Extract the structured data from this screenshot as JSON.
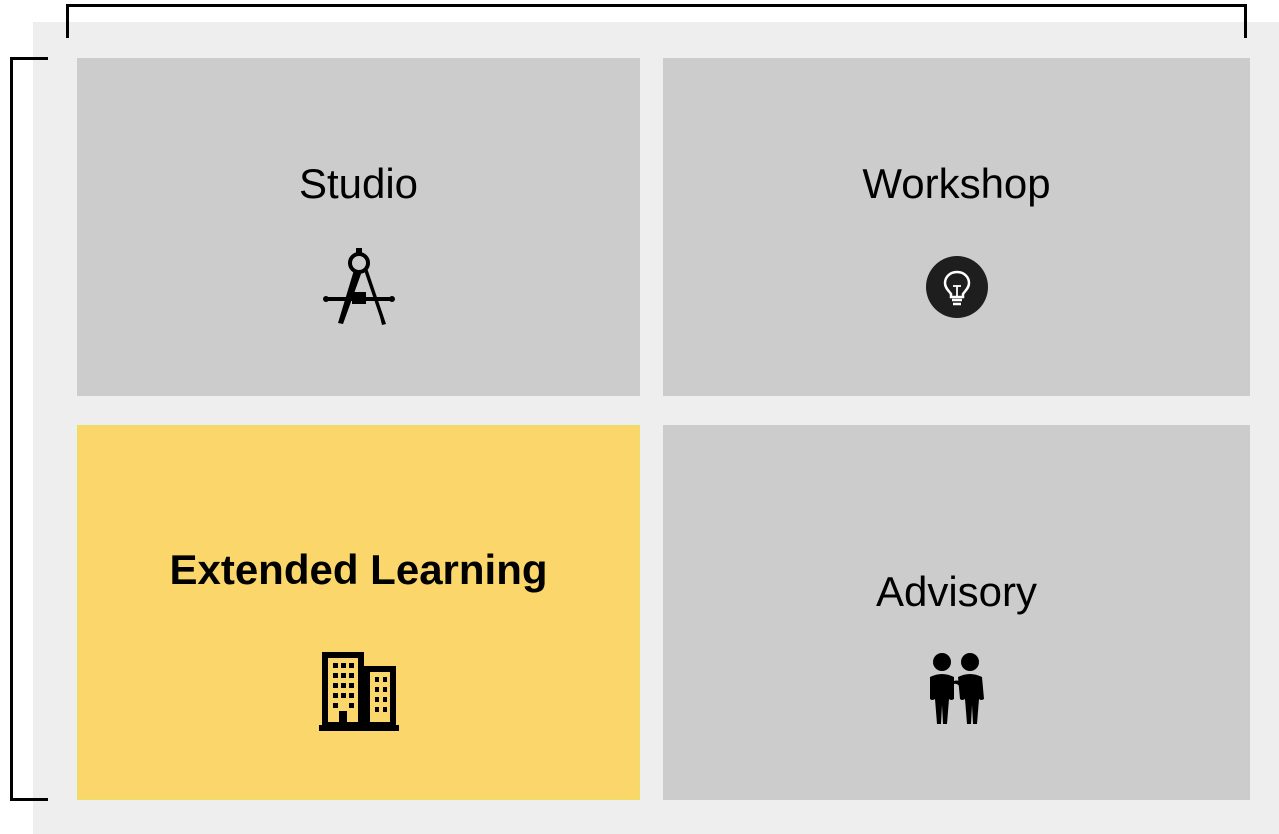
{
  "colors": {
    "panel_background": "#eeeeee",
    "tile_default": "#cccccc",
    "tile_highlight": "#fad66b",
    "ink": "#000000"
  },
  "tiles": [
    {
      "label": "Studio",
      "icon": "drafting-compass-icon",
      "highlighted": false
    },
    {
      "label": "Workshop",
      "icon": "lightbulb-icon",
      "highlighted": false
    },
    {
      "label": "Extended Learning",
      "icon": "office-buildings-icon",
      "highlighted": true
    },
    {
      "label": "Advisory",
      "icon": "two-people-icon",
      "highlighted": false
    }
  ]
}
